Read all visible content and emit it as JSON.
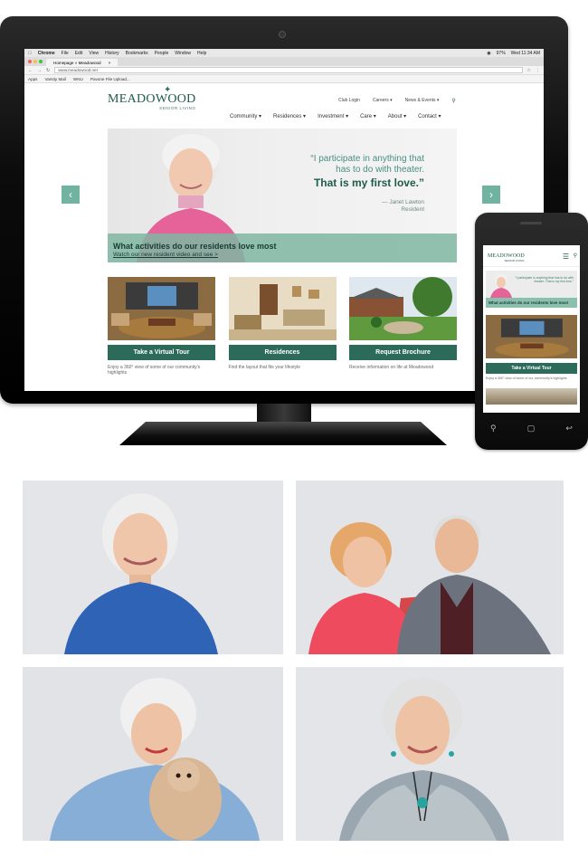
{
  "mac_menubar": {
    "app": "Chrome",
    "menus": [
      "File",
      "Edit",
      "View",
      "History",
      "Bookmarks",
      "People",
      "Window",
      "Help"
    ],
    "battery": "97%",
    "clock": "Wed 11:34 AM"
  },
  "browser": {
    "tab_title": "Homepage » Meadowood",
    "url": "www.meadowood.net",
    "bookmarks": [
      "Apps",
      "Varsity Mail",
      "WNU",
      "Pavone File Upload..."
    ]
  },
  "site": {
    "logo": {
      "name": "MEADOWOOD",
      "subtitle": "SENIOR LIVING"
    },
    "utility_nav": [
      "Club Login",
      "Careers ▾",
      "News & Events ▾"
    ],
    "main_nav": [
      "Community ▾",
      "Residences ▾",
      "Investment ▾",
      "Care ▾",
      "About ▾",
      "Contact ▾"
    ],
    "hero": {
      "quote_line1": "“I participate in anything that",
      "quote_line2": "has to do with theater.",
      "quote_emphasis": "That is my first love.”",
      "author": "— Janet Lawton",
      "author_role": "Resident",
      "band_heading": "What activities do our residents love most",
      "band_link": "Watch our new resident video and see >"
    },
    "cards": [
      {
        "button": "Take a Virtual Tour",
        "desc": "Enjoy a 360° view of some of our community's highlights"
      },
      {
        "button": "Residences",
        "desc": "Find the layout that fits your lifestyle"
      },
      {
        "button": "Request Brochure",
        "desc": "Receive information on life at Meadowood"
      }
    ]
  },
  "phone": {
    "logo": "MEADOWOOD",
    "logo_sub": "SENIOR LIVING",
    "quote": "“I participate in anything that has to do with theater. That is my first love.”",
    "band": "What activities do our residents love most",
    "card_button": "Take a Virtual Tour",
    "card_desc": "Enjoy a 360° view of some of our community's highlights"
  },
  "colors": {
    "brand_green": "#2c6b59",
    "accent_mint": "#7fb6a2"
  }
}
